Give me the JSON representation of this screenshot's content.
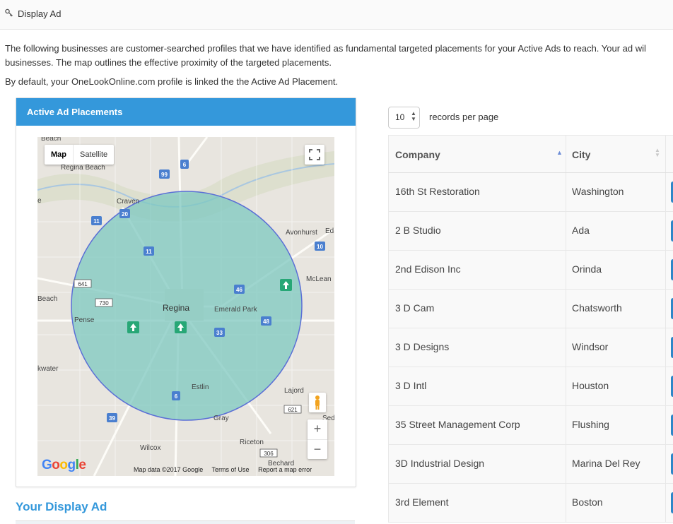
{
  "header": {
    "icon": "key-icon",
    "title": "Display Ad"
  },
  "intro": {
    "line1": "The following businesses are customer-searched profiles that we have identified as fundamental targeted placements for your Active Ads to reach. Your ad wil",
    "line2": "businesses. The map outlines the effective proximity of the targeted placements.",
    "default_note": "By default, your OneLookOnline.com profile is linked the the Active Ad Placement."
  },
  "panel": {
    "title": "Active Ad Placements",
    "accent": "#3498db"
  },
  "map": {
    "type_buttons": [
      "Map",
      "Satellite"
    ],
    "active_type": "Map",
    "zoom_in": "+",
    "zoom_out": "−",
    "logo": "Google",
    "attribution": "Map data ©2017 Google",
    "terms": "Terms of Use",
    "report": "Report a map error",
    "circle_fill": "#7ec8c0",
    "circle_stroke": "#5b6fd6",
    "labels": {
      "beach_top": "Beach",
      "regina_beach": "Regina Beach",
      "craven": "Craven",
      "avonhurst": "Avonhurst",
      "ed": "Ed",
      "mclean": "McLean",
      "beach_left": "Beach",
      "pense": "Pense",
      "regina": "Regina",
      "emerald_park": "Emerald Park",
      "e_left": "e",
      "kwater": "kwater",
      "estlin": "Estlin",
      "lajord": "Lajord",
      "gray": "Gray",
      "sed": "Sed",
      "wilcox": "Wilcox",
      "riceton": "Riceton",
      "bechard": "Bechard"
    },
    "shields": {
      "s6_top": "6",
      "s99": "99",
      "s20": "20",
      "s11_left": "11",
      "s11_mid": "11",
      "s10": "10",
      "s641": "641",
      "s46": "46",
      "s730": "730",
      "s48": "48",
      "s33": "33",
      "s6_bottom": "6",
      "s39": "39",
      "s621": "621",
      "s306": "306"
    }
  },
  "your_display_ad": "Your Display Ad",
  "table_controls": {
    "records_value": "10",
    "records_label": "records per page"
  },
  "table": {
    "columns": [
      "Company",
      "City"
    ],
    "rows": [
      [
        "16th St Restoration",
        "Washington"
      ],
      [
        "2 B Studio",
        "Ada"
      ],
      [
        "2nd Edison Inc",
        "Orinda"
      ],
      [
        "3 D Cam",
        "Chatsworth"
      ],
      [
        "3 D Designs",
        "Windsor"
      ],
      [
        "3 D Intl",
        "Houston"
      ],
      [
        "35 Street Management Corp",
        "Flushing"
      ],
      [
        "3D Industrial Design",
        "Marina Del Rey"
      ],
      [
        "3rd Element",
        "Boston"
      ]
    ]
  }
}
